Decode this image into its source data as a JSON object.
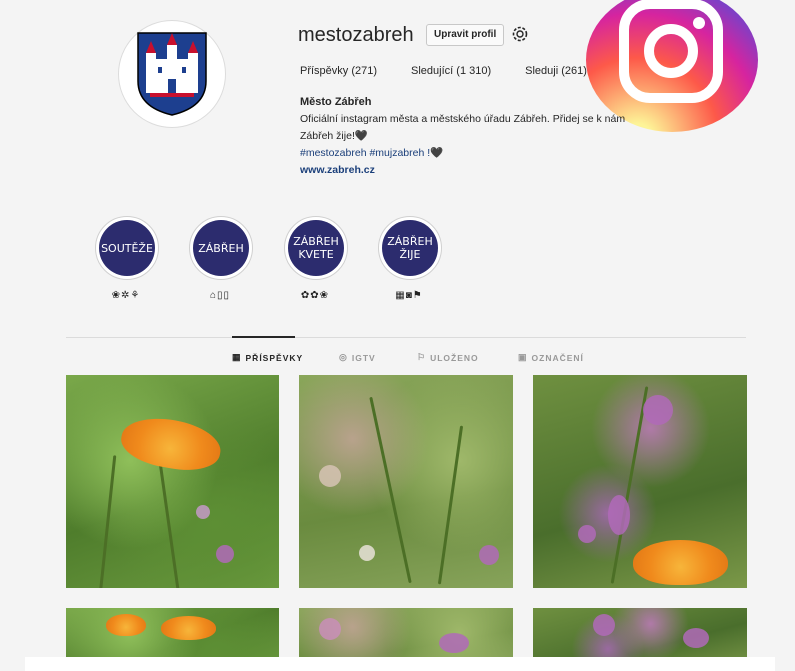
{
  "profile": {
    "username": "mestozabreh",
    "edit_label": "Upravit profil",
    "stats": {
      "posts": "Příspěvky (271)",
      "followers": "Sledující (1 310)",
      "following": "Sleduji (261)"
    },
    "full_name": "Město Zábřeh",
    "bio_line1": "Oficiální instagram města a městského úřadu Zábřeh. Přidej se k nám",
    "bio_line2": "Zábřeh žije!🖤",
    "hashtags": "#mestozabreh #mujzabreh !🖤",
    "website": "www.zabreh.cz"
  },
  "highlights": [
    {
      "title": "SOUTĚŽE",
      "caption": "❀✲⚘"
    },
    {
      "title": "ZÁBŘEH",
      "caption": "⌂▯▯"
    },
    {
      "title": "ZÁBŘEH\nKVETE",
      "caption": "✿✿❀"
    },
    {
      "title": "ZÁBŘEH\nŽIJE",
      "caption": "▦◙⚑"
    }
  ],
  "tabs": [
    {
      "label": "PŘÍSPĚVKY",
      "icon": "grid-icon",
      "glyph": "▦"
    },
    {
      "label": "IGTV",
      "icon": "tv-icon",
      "glyph": "◎"
    },
    {
      "label": "ULOŽENO",
      "icon": "bookmark-icon",
      "glyph": "⚐"
    },
    {
      "label": "OZNAČENÍ",
      "icon": "tag-icon",
      "glyph": "▣"
    }
  ],
  "colors": {
    "link": "#1b3f7a",
    "highlight_bg": "#2c2c6e",
    "shield_blue": "#1d3f8f",
    "shield_red": "#c8102e"
  }
}
